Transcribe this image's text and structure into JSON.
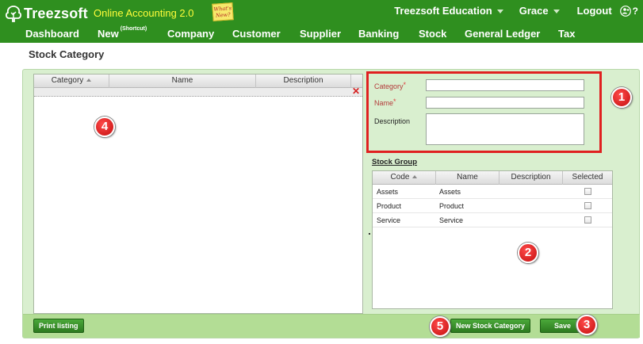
{
  "header": {
    "logo_text": "Treezsoft",
    "subtitle": "Online Accounting 2.0",
    "whats_new": "What's New?",
    "organization": "Treezsoft Education",
    "user": "Grace",
    "logout": "Logout",
    "help": "?"
  },
  "nav": {
    "items": [
      {
        "label": "Dashboard"
      },
      {
        "label": "New",
        "sup": "(Shortcut)"
      },
      {
        "label": "Company"
      },
      {
        "label": "Customer"
      },
      {
        "label": "Supplier"
      },
      {
        "label": "Banking"
      },
      {
        "label": "Stock"
      },
      {
        "label": "General Ledger"
      },
      {
        "label": "Tax"
      }
    ]
  },
  "page": {
    "title": "Stock Category"
  },
  "category_grid": {
    "columns": [
      "Category",
      "Name",
      "Description"
    ]
  },
  "form": {
    "category_label": "Category",
    "name_label": "Name",
    "description_label": "Description",
    "required_mark": "*",
    "category_value": "",
    "name_value": "",
    "description_value": ""
  },
  "stock_group": {
    "title": "Stock Group",
    "columns": [
      "Code",
      "Name",
      "Description",
      "Selected"
    ],
    "rows": [
      {
        "code": "Assets",
        "name": "Assets",
        "description": "",
        "selected": false
      },
      {
        "code": "Product",
        "name": "Product",
        "description": "",
        "selected": false
      },
      {
        "code": "Service",
        "name": "Service",
        "description": "",
        "selected": false
      }
    ]
  },
  "buttons": {
    "print_listing": "Print listing",
    "new_stock_category": "New Stock Category",
    "save": "Save"
  },
  "badges": {
    "form": "1",
    "stock_group": "2",
    "save": "3",
    "category_list": "4",
    "new_category": "5"
  },
  "colors": {
    "header_green": "#2f8f1f",
    "panel_green": "#d9efcf",
    "highlight_red": "#e02020",
    "subtitle_yellow": "#fffd3a"
  }
}
